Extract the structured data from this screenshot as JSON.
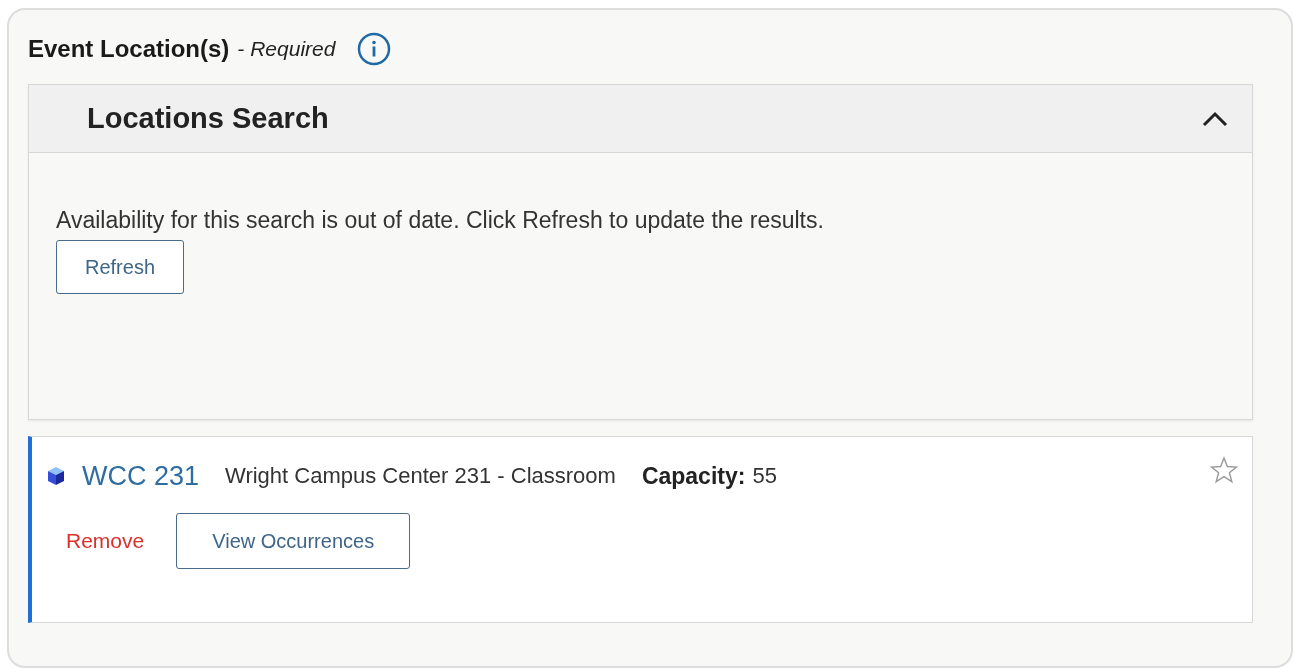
{
  "section": {
    "title": "Event Location(s)",
    "required_note": "- Required"
  },
  "search_panel": {
    "title": "Locations Search",
    "expanded": true,
    "message": "Availability for this search is out of date. Click Refresh to update the results.",
    "refresh_button": "Refresh"
  },
  "locations": [
    {
      "code": "WCC 231",
      "name": "Wright Campus Center 231 - Classroom",
      "capacity_label": "Capacity:",
      "capacity": "55",
      "favorite": false,
      "remove_link": "Remove",
      "occurrences_button": "View Occurrences"
    }
  ]
}
